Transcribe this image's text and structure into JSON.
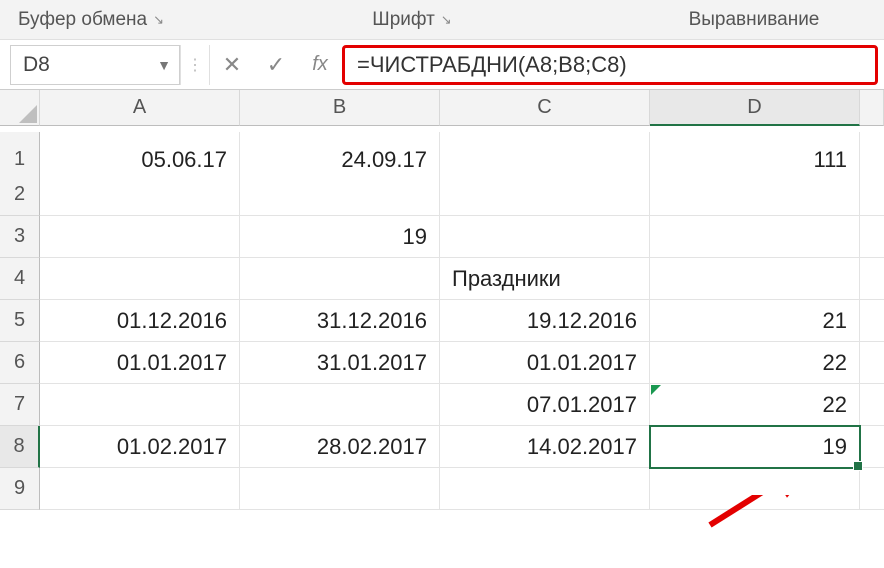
{
  "ribbon": {
    "group1": "Буфер обмена",
    "group2": "Шрифт",
    "group3": "Выравнивание"
  },
  "nameBox": {
    "value": "D8"
  },
  "formulaBar": {
    "cancel": "✕",
    "enter": "✓",
    "fx": "fx",
    "value": "=ЧИСТРАБДНИ(A8;B8;C8)"
  },
  "columns": [
    "A",
    "B",
    "C",
    "D"
  ],
  "rows": [
    "1",
    "2",
    "3",
    "4",
    "5",
    "6",
    "7",
    "8",
    "9"
  ],
  "cells": {
    "A1": "05.06.17",
    "B1": "24.09.17",
    "C1": "",
    "D1": "111",
    "A2": "",
    "B2": "",
    "C2": "",
    "D2": "",
    "A3": "",
    "B3": "19",
    "C3": "",
    "D3": "",
    "A4": "",
    "B4": "",
    "C4": "Праздники",
    "D4": "",
    "A5": "01.12.2016",
    "B5": "31.12.2016",
    "C5": "19.12.2016",
    "D5": "21",
    "A6": "01.01.2017",
    "B6": "31.01.2017",
    "C6": "01.01.2017",
    "D6": "22",
    "A7": "",
    "B7": "",
    "C7": "07.01.2017",
    "D7": "22",
    "A8": "01.02.2017",
    "B8": "28.02.2017",
    "C8": "14.02.2017",
    "D8": "19",
    "A9": "",
    "B9": "",
    "C9": "",
    "D9": ""
  },
  "selection": {
    "cell": "D8",
    "row": "8",
    "col": "D"
  },
  "chart_data": null
}
